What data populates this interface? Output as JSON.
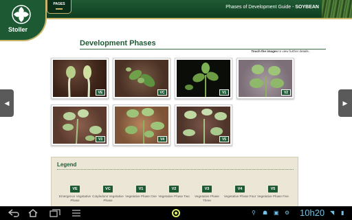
{
  "header": {
    "pages_label": "PAGES",
    "title_prefix": "Phases of Development Guide - ",
    "title_bold": "SOYBEAN"
  },
  "logo": {
    "text": "Stoller"
  },
  "main": {
    "title": "Development Phases",
    "hint_bold": "Touch the images",
    "hint_rest": " to view further details.",
    "thumbnails": [
      {
        "badge": "VE"
      },
      {
        "badge": "VC"
      },
      {
        "badge": "V1"
      },
      {
        "badge": "V2"
      },
      {
        "badge": "V3"
      },
      {
        "badge": "V4"
      },
      {
        "badge": "V5"
      }
    ]
  },
  "legend": {
    "title": "Legend",
    "items": [
      {
        "code": "VE",
        "label": "Emergence Vegetative Phase"
      },
      {
        "code": "VC",
        "label": "Cotyledons Vegetative Phase"
      },
      {
        "code": "V1",
        "label": "Vegetative Phase One"
      },
      {
        "code": "V2",
        "label": "Vegetative Phase Two"
      },
      {
        "code": "V3",
        "label": "Vegetative Phase Three"
      },
      {
        "code": "V4",
        "label": "Vegetative Phase Four"
      },
      {
        "code": "V5",
        "label": "Vegetative Phase Five"
      }
    ]
  },
  "navigation": {
    "prev_icon": "chevron-left-icon",
    "next_icon": "chevron-right-icon"
  },
  "system_bar": {
    "clock": "10h20",
    "icons": [
      "back-icon",
      "home-icon",
      "recent-apps-icon",
      "app-launcher-icon",
      "usb-icon",
      "android-icon",
      "screenshot-icon",
      "wifi-icon",
      "battery-icon"
    ]
  },
  "colors": {
    "brand_green": "#1d5a34",
    "gold_accent": "#c9b46a",
    "legend_bg": "#ece6d7",
    "clock_blue": "#6fc3ea"
  }
}
